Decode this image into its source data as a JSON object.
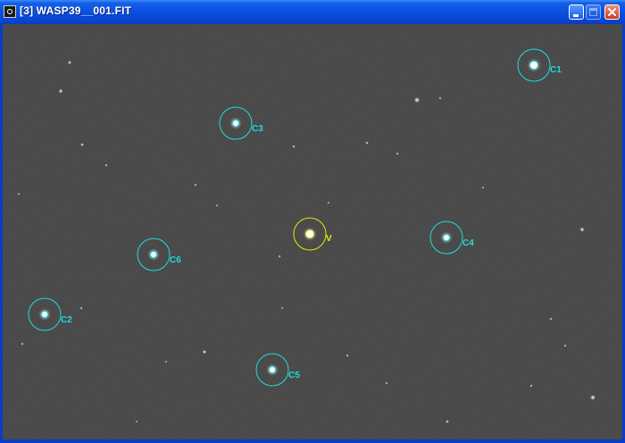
{
  "window": {
    "title": "[3] WASP39__001.FIT",
    "icon": "image-window-icon",
    "controls": [
      "minimize-button",
      "maximize-button",
      "close-button"
    ],
    "colors": {
      "titlebar": "#0a4fe0",
      "close": "#d2391a",
      "comparison": "#1fdcdc",
      "variable": "#e6e600",
      "sky": "#2b2b2b"
    }
  },
  "apertures": {
    "c1": {
      "label": "C1"
    },
    "c2": {
      "label": "C2"
    },
    "c3": {
      "label": "C3"
    },
    "c4": {
      "label": "C4"
    },
    "c5": {
      "label": "C5"
    },
    "c6": {
      "label": "C6"
    },
    "v": {
      "label": "V"
    }
  }
}
